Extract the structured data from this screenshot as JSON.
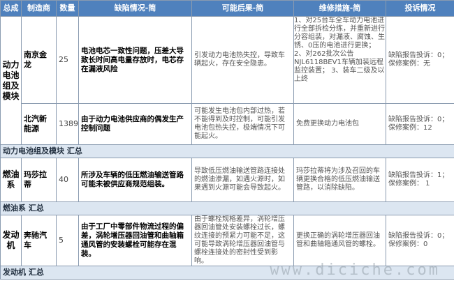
{
  "headers": [
    "总成",
    "制造商",
    "数量",
    "缺陷情况-简",
    "可能后果-简",
    "维修措施-简",
    "投诉情况"
  ],
  "rows": [
    {
      "system": "动力电池组及模块",
      "manufacturer": "南京金龙",
      "quantity": "25",
      "defect": "电池电芯一致性问题，压差大导致长时间高电量存放时，电芯存在漏液风险",
      "consequence": "引发动力电池热失控，导致车辆起火，存在安全隐患。",
      "measures": "1、对25台车全车动力电池进行全部拆检分练，并重新进行分容组装，对漏液、腐蚀、生锈、0压的电池进行更换； 2、对262批次公告NJL6118BEV1车辆加装远程监控装置； 3、装车二级及以上终",
      "complaint": "缺陷报告投诉：0；保修案例：无"
    },
    {
      "manufacturer": "北汽新能源",
      "quantity": "1389",
      "defect": "由于动力电池供应商的偶发生产控制问题",
      "consequence": "可能发生电池包内部过热，若不能得到及时控制，可能引发电池包热失控，极端情况下可能起火。",
      "measures": "免费更换动力电池包",
      "complaint": "缺陷报告投诉：0；保修案例：12"
    }
  ],
  "subtotal_1": "动力电池组及模块 汇总",
  "rows_2": [
    {
      "system": "燃油系",
      "manufacturer": "玛莎拉蒂",
      "quantity": "40",
      "defect": "所涉及车辆的低压燃油输送管路可能未被供应商规范组装。",
      "consequence": "导致低压燃油输送管路连接处的燃油渗漏，如遇火源时，如果遇到火源可能会导致起火。",
      "measures": "玛莎拉蒂将为涉及召回的车辆更换合格的低压燃油输送管路，以消除缺陷。",
      "complaint": "缺陷报告投诉：1；保修案例： 1"
    }
  ],
  "subtotal_2": "燃油系 汇总",
  "rows_3": [
    {
      "system": "发动机",
      "manufacturer": "奔驰汽车",
      "quantity": "5",
      "defect": "由于工厂中零部件物流过程的偏差，涡轮增压器回油管和曲轴箱通风管的安装螺栓可能存在混装。",
      "consequence": "由于螺栓规格差异，涡轮增压器回油管处安装螺栓过长，螺纹连接的预紧力可能不足，这可能导致涡轮增压器回油管与螺栓连接处的密封性受到影响。",
      "measures": "更换正确的涡轮增压器回油管和曲轴箱通风管的螺栓。",
      "complaint": "缺陷报告投诉：0；保修案例：0"
    }
  ],
  "subtotal_3": "发动机 汇总",
  "watermark": "www.diciche.com"
}
